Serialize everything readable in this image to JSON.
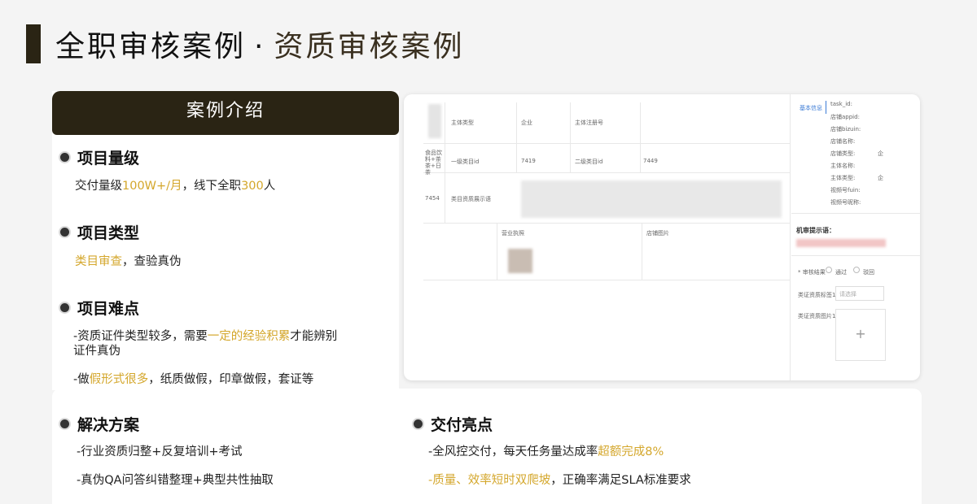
{
  "header": {
    "title_main": "全职审核案例",
    "separator": "·",
    "title_sub": "资质审核案例"
  },
  "intro": {
    "label": "案例介绍",
    "scale": {
      "heading": "项目量级",
      "prefix": "交付量级",
      "volume": "100W+/月",
      "mid": "，线下全职",
      "staff": "300",
      "suffix": "人"
    },
    "type": {
      "heading": "项目类型",
      "highlight": "类目审查",
      "rest": "，查验真伪"
    },
    "difficulty": {
      "heading": "项目难点",
      "line1_a": "-资质证件类型较多，需要",
      "line1_hl": "一定的经验积累",
      "line1_b": "才能辨别",
      "line1_c": "证件真伪",
      "line2_a": "-做",
      "line2_hl": "假形式很多",
      "line2_b": "，纸质做假，印章做假，套证等"
    }
  },
  "solution": {
    "heading": "解决方案",
    "items": [
      "-行业资质归整+反复培训+考试",
      "-真伪QA问答纠错整理+典型共性抽取"
    ]
  },
  "highlights": {
    "heading": "交付亮点",
    "line1_a": "-全风控交付，每天任务量达成率",
    "line1_hl": "超额完成8%",
    "line2_hl": "-质量、效率短时双爬坡",
    "line2_b": "，正确率满足SLA标准要求"
  },
  "screenshot": {
    "subject_type_label": "主体类型",
    "subject_type_value": "企业",
    "subject_reg_label": "主体注册号",
    "category_name": "食品饮料+茶茶+日茶",
    "cat1_label": "一级类目id",
    "cat1_value": "7419",
    "cat2_label": "二级类目id",
    "cat2_value": "7449",
    "cat3_value": "7454",
    "qual_label": "类目资质展示语",
    "license_label": "营业执照",
    "shop_image_label": "店铺图片",
    "side_tab": "基本信息",
    "side_fields": [
      "task_id:",
      "店铺appid:",
      "店铺bizuin:",
      "店铺名称:",
      "店铺类型:",
      "主体名称:",
      "主体类型:",
      "视频号fuin:",
      "视频号昵称:"
    ],
    "side_values": [
      "企",
      "企"
    ],
    "machine_hint_label": "机审提示语：",
    "result_label": "* 审核结果",
    "option_pass": "通过",
    "option_reject": "驳回",
    "reason_label": "类证资质标签1",
    "reason_placeholder": "请选择",
    "image_label": "类证资质图片1",
    "upload_symbol": "+"
  }
}
